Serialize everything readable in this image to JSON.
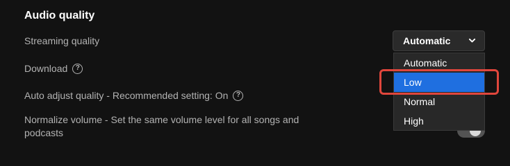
{
  "section": {
    "title": "Audio quality"
  },
  "settings": {
    "streaming_label": "Streaming quality",
    "download_label": "Download",
    "auto_adjust_label": "Auto adjust quality - Recommended setting: On",
    "normalize_label": "Normalize volume - Set the same volume level for all songs and podcasts",
    "help_glyph": "?"
  },
  "streaming_select": {
    "value": "Automatic",
    "options": [
      "Automatic",
      "Low",
      "Normal",
      "High"
    ],
    "highlighted_option": "Low"
  },
  "normalize_toggle": {
    "state": "off"
  },
  "colors": {
    "background": "#121212",
    "highlight": "#1f6fe0",
    "annotation": "#e0463c"
  },
  "icons": {
    "help": "question-circle-icon",
    "chevron": "chevron-down-icon"
  }
}
